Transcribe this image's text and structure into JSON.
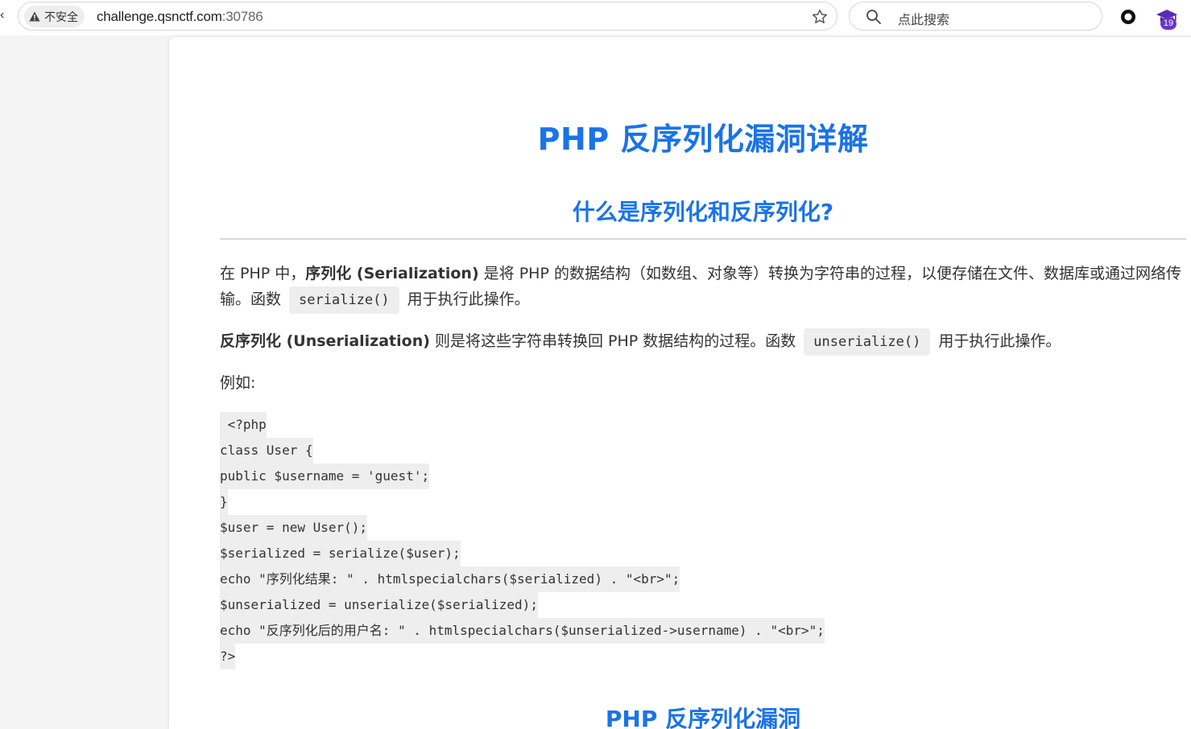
{
  "browser": {
    "security_label": "不安全",
    "url_host": "challenge.qsnctf.com",
    "url_port": ":30786",
    "search_placeholder": "点此搜索",
    "extension_badge": "19"
  },
  "page": {
    "title": "PHP 反序列化漏洞详解",
    "section1_title": "什么是序列化和反序列化?",
    "p1": {
      "before_bold": "在 PHP 中，",
      "bold": "序列化 (Serialization)",
      "after_bold": " 是将 PHP 的数据结构（如数组、对象等）转换为字符串的过程，以便存储在文件、数据库或通过网络传输。函数 ",
      "code": "serialize()",
      "after_code": " 用于执行此操作。"
    },
    "p2": {
      "bold": "反序列化 (Unserialization)",
      "after_bold": " 则是将这些字符串转换回 PHP 数据结构的过程。函数 ",
      "code": "unserialize()",
      "after_code": " 用于执行此操作。"
    },
    "example_label": "例如:",
    "code_lines": [
      " <?php",
      "class User {",
      "public $username = 'guest';",
      "}",
      "$user = new User();",
      "$serialized = serialize($user);",
      "echo \"序列化结果: \" . htmlspecialchars($serialized) . \"<br>\";",
      "$unserialized = unserialize($serialized);",
      "echo \"反序列化后的用户名: \" . htmlspecialchars($unserialized->username) . \"<br>\";",
      "?>"
    ],
    "section2_title": "PHP 反序列化漏洞"
  }
}
